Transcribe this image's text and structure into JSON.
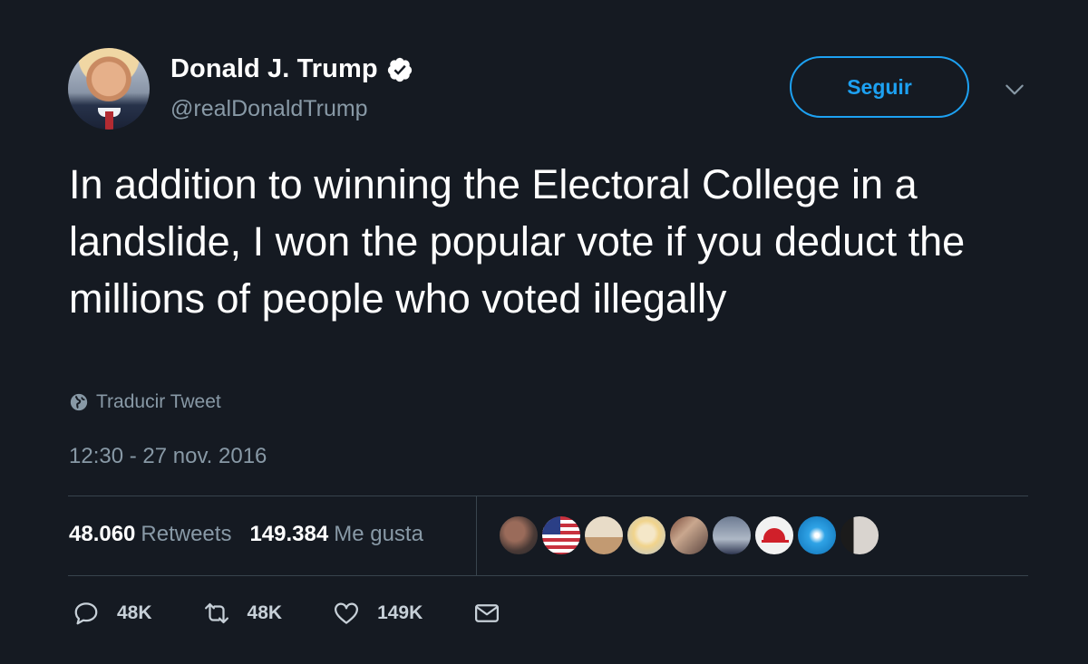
{
  "author": {
    "display_name": "Donald J. Trump",
    "handle": "@realDonaldTrump",
    "verified": true,
    "avatar_icon": "profile-photo"
  },
  "follow_button_label": "Seguir",
  "tweet": {
    "text": "In addition to winning the Electoral College in a landslide, I won the popular vote if you deduct the millions of people who voted illegally",
    "translate_label": "Traducir Tweet",
    "timestamp": "12:30 - 27 nov. 2016"
  },
  "stats": {
    "retweets_count": "48.060",
    "retweets_label": "Retweets",
    "likes_count": "149.384",
    "likes_label": "Me gusta"
  },
  "likers": [
    {
      "icon": "liker-avatar-1"
    },
    {
      "icon": "liker-avatar-usa-flag"
    },
    {
      "icon": "liker-avatar-3"
    },
    {
      "icon": "liker-avatar-4"
    },
    {
      "icon": "liker-avatar-5"
    },
    {
      "icon": "liker-avatar-6"
    },
    {
      "icon": "liker-avatar-red-cap"
    },
    {
      "icon": "liker-avatar-8"
    },
    {
      "icon": "liker-avatar-9"
    }
  ],
  "actions": {
    "reply_count": "48K",
    "retweet_count": "48K",
    "like_count": "149K"
  },
  "colors": {
    "background": "#151a22",
    "accent": "#1da1f2",
    "secondary_text": "#8899a6"
  }
}
